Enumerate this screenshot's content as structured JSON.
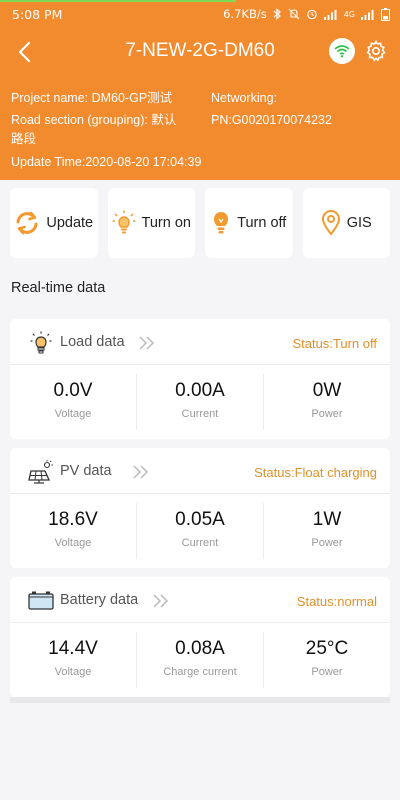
{
  "status_bar": {
    "time": "5:08 PM",
    "net_speed": "6.7KB/s",
    "network_type": "4G"
  },
  "header": {
    "title": "7-NEW-2G-DM60",
    "project_name": "Project name: DM60-GP测试",
    "road_section_line1": "Road section (grouping): 默认",
    "road_section_line2": "路段",
    "update_time": "Update Time:2020-08-20 17:04:39",
    "networking": "Networking:",
    "pn": "PN:G0020170074232"
  },
  "actions": [
    {
      "label": "Update",
      "icon": "refresh-icon"
    },
    {
      "label": "Turn on",
      "icon": "bulb-on-icon"
    },
    {
      "label": "Turn off",
      "icon": "bulb-off-icon"
    },
    {
      "label": "GIS",
      "icon": "location-pin-icon"
    }
  ],
  "section_label": "Real-time data",
  "cards": {
    "load": {
      "title": "Load data",
      "status": "Status:Turn off",
      "metrics": [
        {
          "value": "0.0V",
          "label": "Voltage"
        },
        {
          "value": "0.00A",
          "label": "Current"
        },
        {
          "value": "0W",
          "label": "Power"
        }
      ]
    },
    "pv": {
      "title": "PV data",
      "status": "Status:Float charging",
      "metrics": [
        {
          "value": "18.6V",
          "label": "Voltage"
        },
        {
          "value": "0.05A",
          "label": "Current"
        },
        {
          "value": "1W",
          "label": "Power"
        }
      ]
    },
    "battery": {
      "title": "Battery data",
      "status": "Status:normal",
      "metrics": [
        {
          "value": "14.4V",
          "label": "Voltage"
        },
        {
          "value": "0.08A",
          "label": "Charge current"
        },
        {
          "value": "25°C",
          "label": "Power"
        }
      ]
    }
  },
  "colors": {
    "header_bg": "#f28a2e",
    "accent": "#e0912a",
    "page_bg": "#f5f5f7",
    "wifi_green": "#2fbf4a"
  }
}
